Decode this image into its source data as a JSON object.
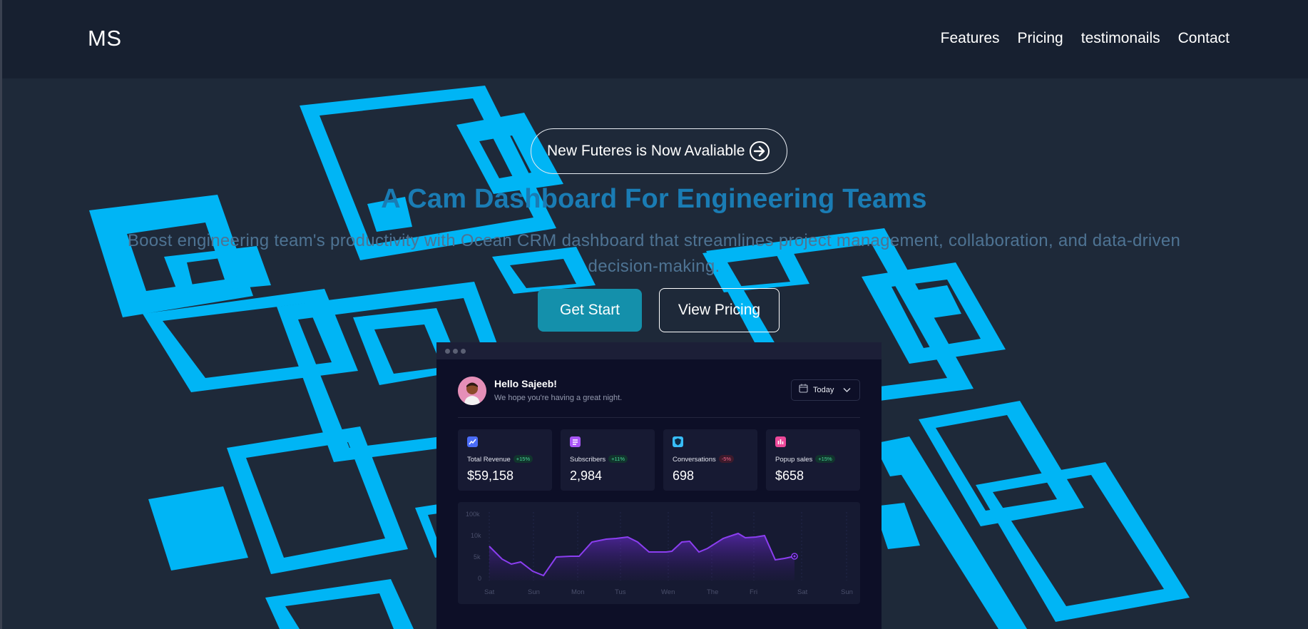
{
  "brand": {
    "logo": "MS"
  },
  "nav": {
    "links": [
      "Features",
      "Pricing",
      "testimonails",
      "Contact"
    ]
  },
  "hero": {
    "announcement": "New Futeres is Now Avaliable",
    "headline": "A Cam Dashboard For Engineering Teams",
    "subtext": "Boost engineering team's productivity with Ocean CRM dashboard that streamlines project management, collaboration, and data-driven decision-making.",
    "primary_cta": "Get Start",
    "secondary_cta": "View Pricing"
  },
  "dashboard": {
    "greeting": "Hello Sajeeb!",
    "subgreeting": "We hope you're having a great night.",
    "date_filter": "Today",
    "stats": [
      {
        "label": "Total Revenue",
        "badge": "+15%",
        "trend": "up",
        "value": "$59,158",
        "icon": "chart-up-icon",
        "color": "#4a6cf7"
      },
      {
        "label": "Subscribers",
        "badge": "+11%",
        "trend": "up",
        "value": "2,984",
        "icon": "document-icon",
        "color": "#a855f7"
      },
      {
        "label": "Conversations",
        "badge": "-5%",
        "trend": "down",
        "value": "698",
        "icon": "shield-icon",
        "color": "#38bdf8"
      },
      {
        "label": "Popup sales",
        "badge": "+15%",
        "trend": "up",
        "value": "$658",
        "icon": "bar-chart-icon",
        "color": "#ec4899"
      }
    ],
    "chart": {
      "y_ticks": [
        "100k",
        "10k",
        "5k",
        "0"
      ],
      "x_ticks": [
        "Sat",
        "Sun",
        "Mon",
        "Tus",
        "Wen",
        "The",
        "Fri",
        "Sat",
        "Sun"
      ]
    }
  },
  "colors": {
    "background": "#1e2939",
    "navbar": "#172030",
    "shape_fill": "#00b5f5",
    "headline": "#1a7cb4",
    "primary_button": "#1490ab",
    "dashboard_bg": "#0d0f27",
    "chart_line": "#8b3ef0"
  }
}
